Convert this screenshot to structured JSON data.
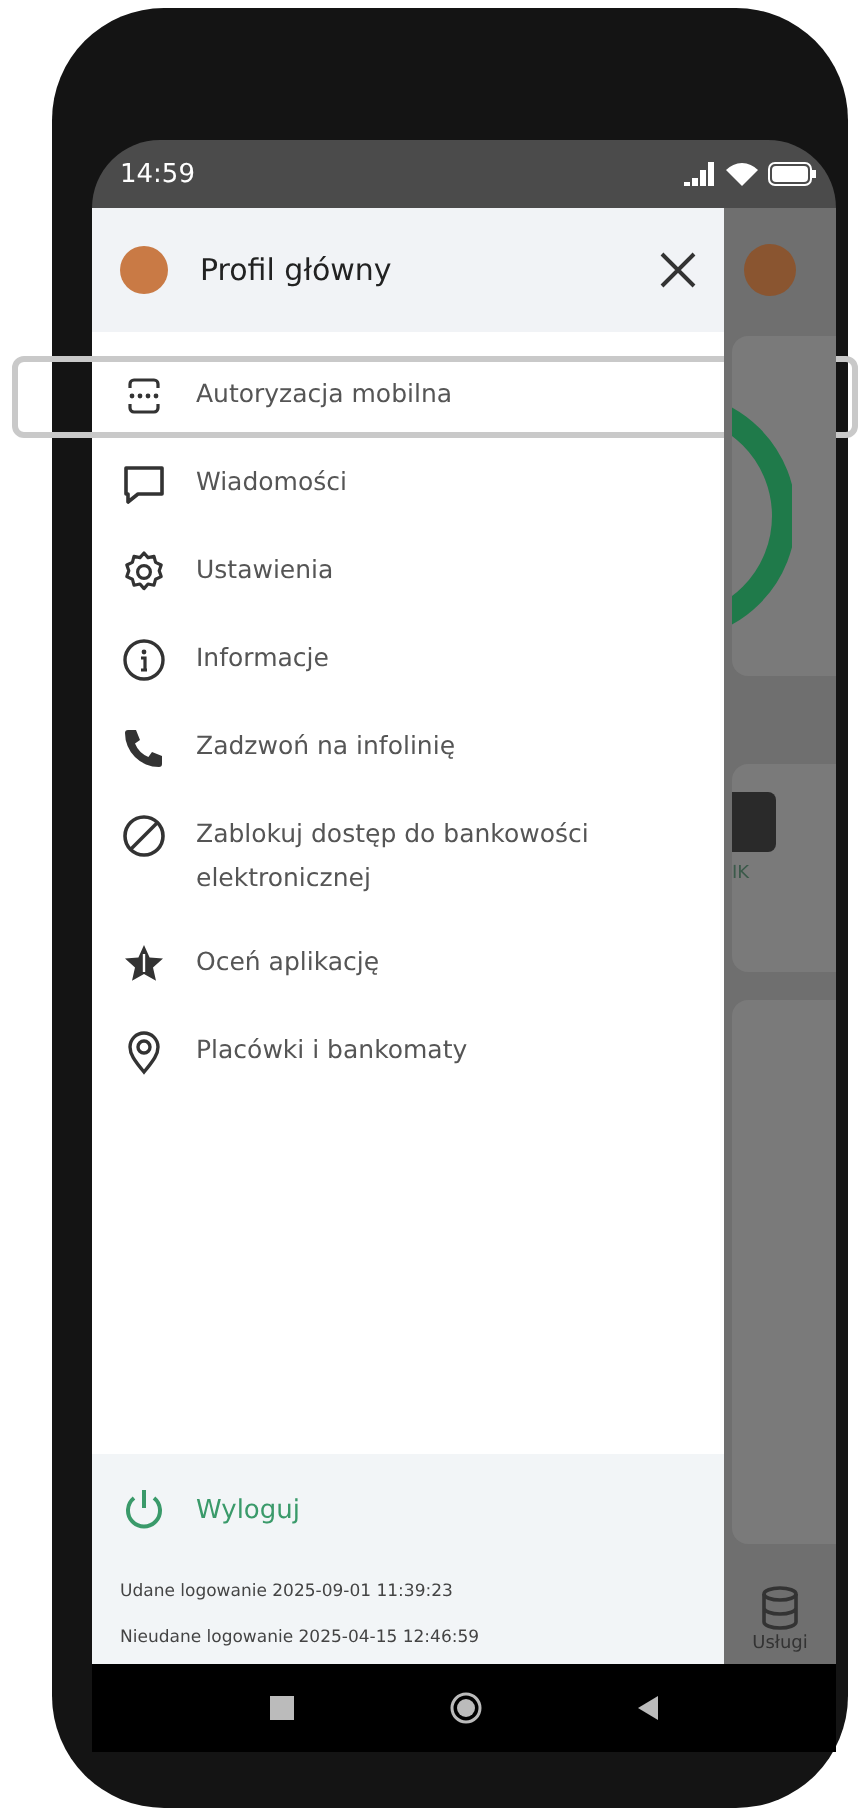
{
  "status_bar": {
    "time": "14:59"
  },
  "drawer": {
    "title": "Profil główny",
    "items": [
      {
        "label": "Autoryzacja mobilna",
        "kind": "auth",
        "highlighted": true
      },
      {
        "label": "Wiadomości",
        "kind": "message",
        "highlighted": false
      },
      {
        "label": "Ustawienia",
        "kind": "gear",
        "highlighted": false
      },
      {
        "label": "Informacje",
        "kind": "info",
        "highlighted": false
      },
      {
        "label": "Zadzwoń na infolinię",
        "kind": "phone",
        "highlighted": false
      },
      {
        "label": "Zablokuj dostęp do bankowości elektronicznej",
        "kind": "block",
        "highlighted": false
      },
      {
        "label": "Oceń aplikację",
        "kind": "star",
        "highlighted": false
      },
      {
        "label": "Placówki i bankomaty",
        "kind": "pin",
        "highlighted": false
      }
    ],
    "logout": {
      "label": "Wyloguj"
    },
    "login_info": [
      "Udane logowanie 2025-09-01 11:39:23",
      "Nieudane logowanie 2025-04-15 12:46:59"
    ]
  },
  "background": {
    "tile_label": "IK",
    "nav_item": "Usługi"
  }
}
